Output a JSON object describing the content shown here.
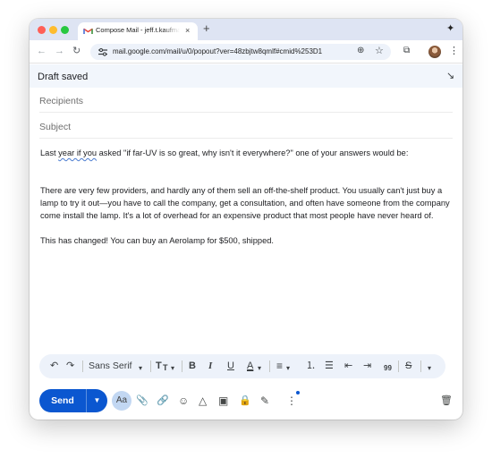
{
  "browser": {
    "tab_title": "Compose Mail - jeff.t.kaufman",
    "tab_close": "×",
    "new_tab": "+",
    "url": "mail.google.com/mail/u/0/popout?ver=48zbjtw8qmlf#cmid%253D1",
    "icons": {
      "back": "←",
      "forward": "→",
      "reload": "↻",
      "zoom": "⊕",
      "star": "☆",
      "extensions": "⧉",
      "menu": "⋮",
      "ext_top": "✦"
    }
  },
  "compose": {
    "status": "Draft saved",
    "expand_icon": "↘",
    "recipients_placeholder": "Recipients",
    "subject_placeholder": "Subject",
    "body": {
      "line1_before": "Last ",
      "line1_spell": "year if you",
      "line1_after": " asked \"if far-UV is so great, why isn't it everywhere?\" one of your answers would be:",
      "para2": "There are very few providers, and hardly any of them sell an off-the-shelf product. You usually can't just buy a lamp to try it out—you have to call the company, get a consultation, and often have someone from the company come install the lamp. It's a lot of overhead for an expensive product that most people have never heard of.",
      "para3": "This has changed! You can buy an Aerolamp for $500, shipped."
    }
  },
  "format_bar": {
    "undo": "↶",
    "redo": "↷",
    "font": "Sans Serif",
    "font_caret": "▾",
    "size": "T",
    "size_caret": "▾",
    "bold": "B",
    "italic": "I",
    "underline": "U",
    "text_color": "A",
    "color_caret": "▾",
    "align": "≡",
    "align_caret": "▾",
    "numbered_list": "⒈",
    "bulleted_list": "☰",
    "indent_less": "⇤",
    "indent_more": "⇥",
    "quote": "99",
    "strikethrough": "S",
    "more": "▾"
  },
  "actions": {
    "send": "Send",
    "send_options": "▼",
    "formatting": "Aa",
    "attach": "📎",
    "link": "🔗",
    "emoji": "☺",
    "drive": "△",
    "photo": "▣",
    "confidential": "🔒",
    "signature": "✎",
    "more": "⋮",
    "discard": "🗑"
  },
  "colors": {
    "send_blue": "#0b57d0",
    "header_bg": "#f2f6fc",
    "format_bar_bg": "#edf2fa"
  }
}
